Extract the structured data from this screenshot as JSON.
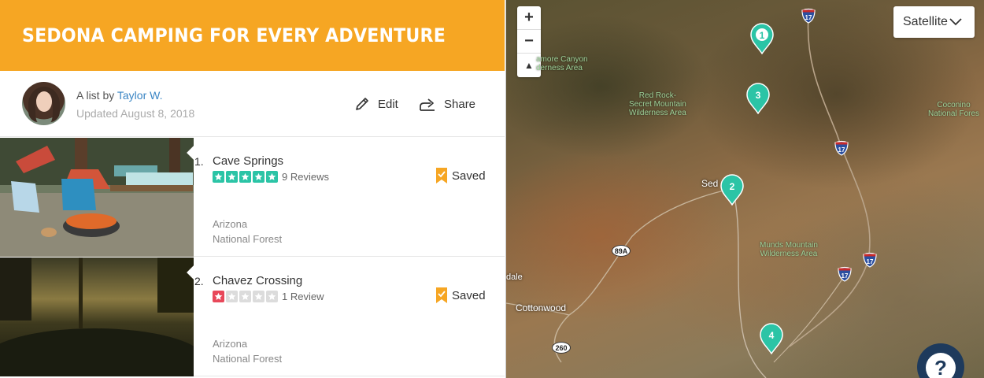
{
  "list": {
    "title": "Sedona Camping for Every Adventure",
    "byline_prefix": "A list by ",
    "author": "Taylor W.",
    "updated": "Updated August 8, 2018",
    "edit_label": "Edit",
    "share_label": "Share"
  },
  "items": [
    {
      "number": "1.",
      "name": "Cave Springs",
      "rating": 5,
      "reviews": "9 Reviews",
      "saved_label": "Saved",
      "state": "Arizona",
      "type": "National Forest",
      "star_color": "#2bc4a6"
    },
    {
      "number": "2.",
      "name": "Chavez Crossing",
      "rating": 1,
      "reviews": "1 Review",
      "saved_label": "Saved",
      "state": "Arizona",
      "type": "National Forest",
      "star_color": "#e8485a"
    }
  ],
  "map": {
    "zoom_in": "+",
    "zoom_out": "−",
    "compass": "▲",
    "map_type": "Satellite",
    "labels": {
      "sycamore": [
        "amore Canyon",
        "derness Area"
      ],
      "redrock": [
        "Red Rock-",
        "Secret Mountain",
        "Wilderness Area"
      ],
      "munds": [
        "Munds Mountain",
        "Wilderness Area"
      ],
      "coconino": [
        "Coconino",
        "National Fores"
      ]
    },
    "towns": {
      "sedona": "Sed",
      "cottonwood": "Cottonwood",
      "dale": "dale"
    },
    "highways": {
      "i17": "17",
      "r89a": "89A",
      "r260": "260"
    },
    "pins": [
      "1",
      "3",
      "2",
      "4"
    ],
    "help": "?"
  },
  "colors": {
    "header": "#f6a623",
    "pin": "#2bc4a6",
    "saved": "#f6a623",
    "link": "#3a85c4"
  }
}
